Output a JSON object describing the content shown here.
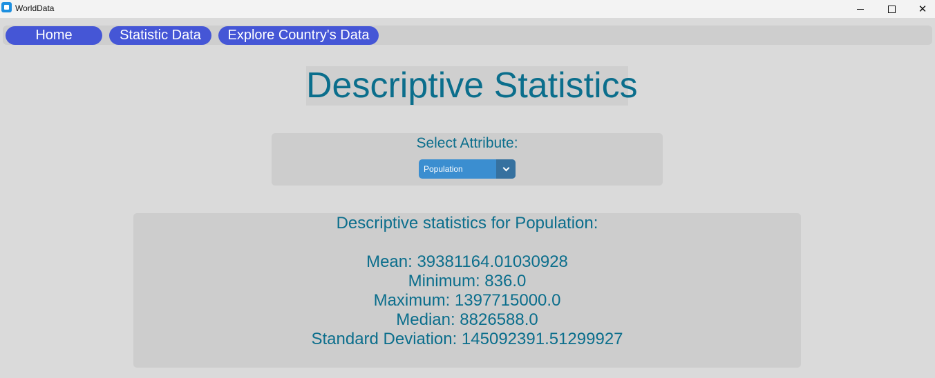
{
  "window": {
    "title": "WorldData"
  },
  "nav": {
    "home": "Home",
    "statistic": "Statistic Data",
    "explore": "Explore Country's Data"
  },
  "page": {
    "title": "Descriptive Statistics"
  },
  "select": {
    "label": "Select Attribute:",
    "value": "Population"
  },
  "stats": {
    "heading": "Descriptive statistics for Population:",
    "mean": "Mean: 39381164.01030928",
    "minimum": "Minimum: 836.0",
    "maximum": "Maximum: 1397715000.0",
    "median": "Median: 8826588.0",
    "std": "Standard Deviation: 145092391.51299927"
  },
  "colors": {
    "accent_text": "#0b6e8c",
    "nav_button": "#4556d6",
    "dropdown": "#3b8ed0",
    "dropdown_arrow": "#36719f"
  }
}
